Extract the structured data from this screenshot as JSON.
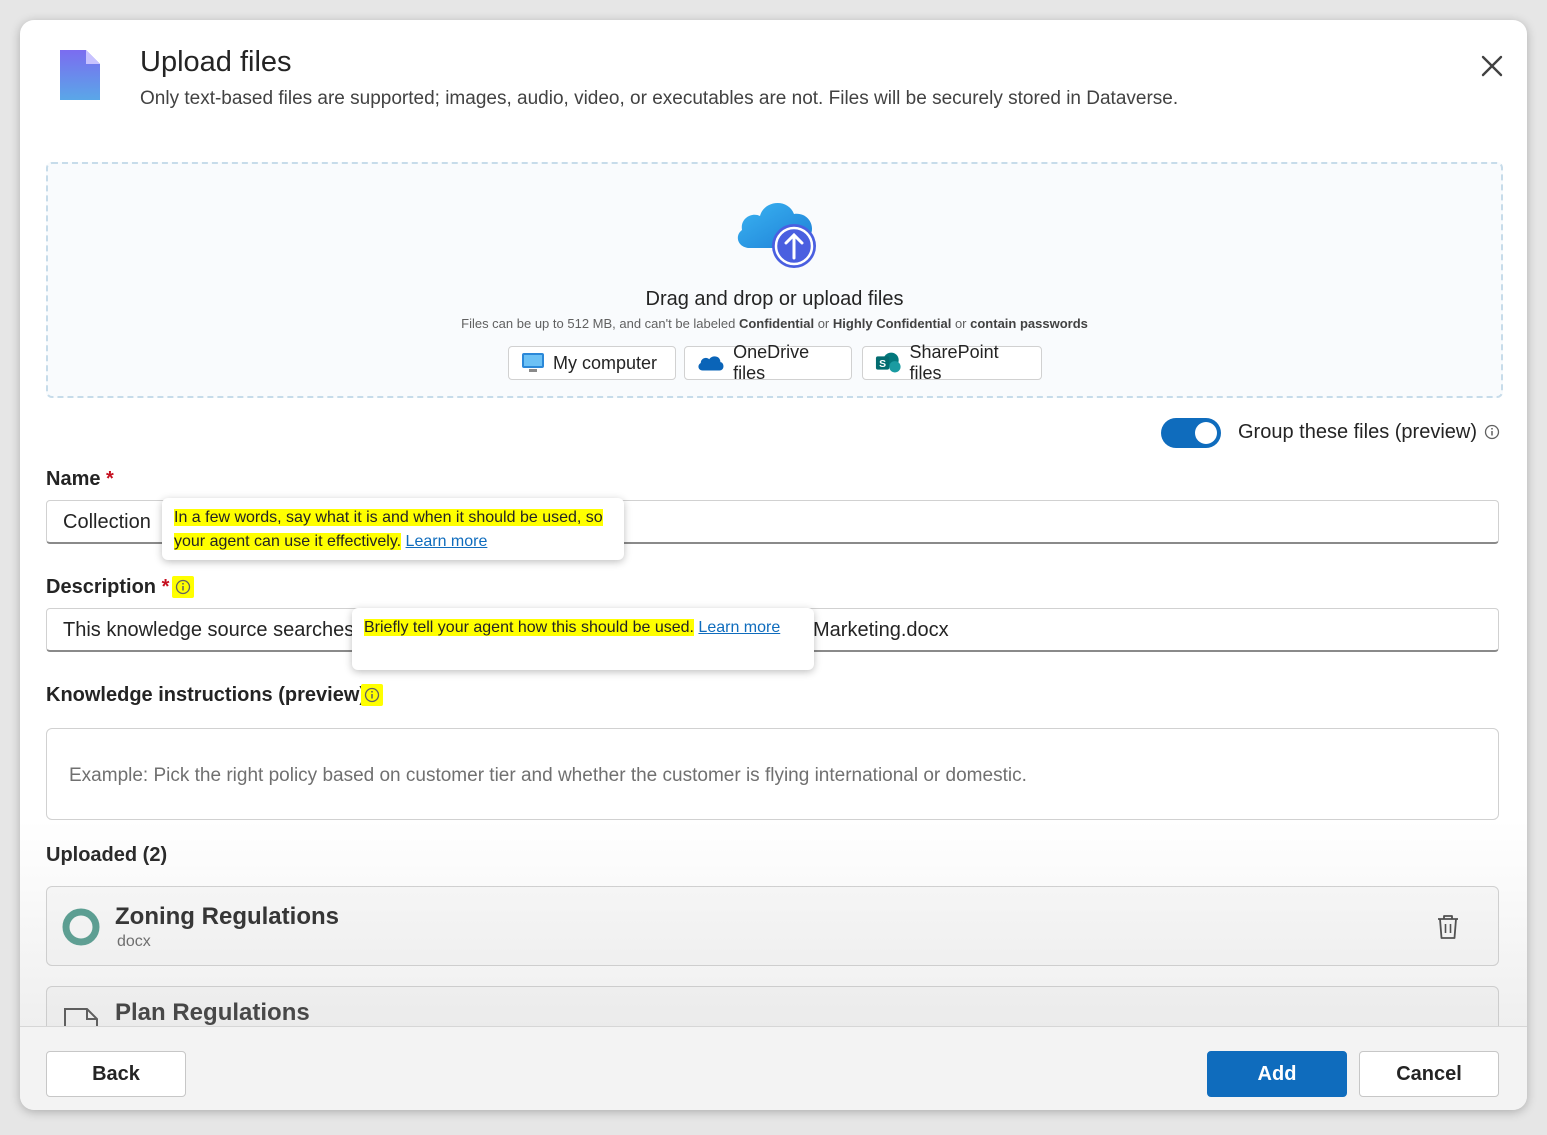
{
  "dialog": {
    "title": "Upload files",
    "subtitle": "Only text-based files are supported; images, audio, video, or executables are not. Files will be securely stored in Dataverse."
  },
  "dropzone": {
    "title": "Drag and drop or upload files",
    "note_prefix": "Files can be up to 512 MB, and can't be labeled ",
    "note_confidential": "Confidential",
    "note_or1": " or ",
    "note_highly": "Highly Confidential",
    "note_or2": " or ",
    "note_passwords": "contain passwords",
    "sources": [
      {
        "label": "My computer",
        "icon": "monitor-icon"
      },
      {
        "label": "OneDrive files",
        "icon": "onedrive-icon"
      },
      {
        "label": "SharePoint files",
        "icon": "sharepoint-icon"
      }
    ]
  },
  "group_toggle": {
    "label": "Group these files (preview)",
    "on": true
  },
  "name_field": {
    "label": "Name",
    "required_mark": "*",
    "value": "Collection",
    "tooltip": "In a few words, say what it is and when it should be used, so your agent can use it effectively.",
    "tooltip_link": "Learn more"
  },
  "description_field": {
    "label": "Description",
    "required_mark": "*",
    "value_start": "This knowledge source searches",
    "value_end": "Marketing.docx",
    "tooltip": "Briefly tell your agent how this should be used.",
    "tooltip_link": "Learn more"
  },
  "instructions_field": {
    "label": "Knowledge instructions (preview)",
    "placeholder": "Example: Pick the right policy based on customer tier and whether the customer is flying international or domestic."
  },
  "uploaded": {
    "heading": "Uploaded (2)",
    "files": [
      {
        "name": "Zoning Regulations",
        "type": "docx"
      },
      {
        "name": "Plan Regulations",
        "type": ""
      }
    ]
  },
  "footer": {
    "back": "Back",
    "add": "Add",
    "cancel": "Cancel"
  },
  "colors": {
    "primary": "#0f6cbd",
    "highlight": "#ffff00",
    "required": "#c50f1f"
  }
}
